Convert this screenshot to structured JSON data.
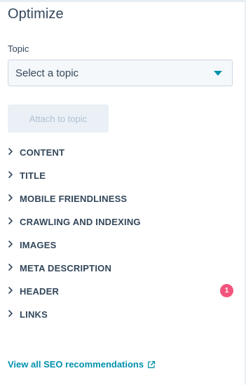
{
  "panel": {
    "title": "Optimize"
  },
  "topic": {
    "label": "Topic",
    "selected": "Select a topic"
  },
  "attach_button": {
    "label": "Attach to topic",
    "disabled": true
  },
  "categories": [
    {
      "label": "CONTENT"
    },
    {
      "label": "TITLE"
    },
    {
      "label": "MOBILE FRIENDLINESS"
    },
    {
      "label": "CRAWLING AND INDEXING"
    },
    {
      "label": "IMAGES"
    },
    {
      "label": "META DESCRIPTION"
    },
    {
      "label": "HEADER",
      "badge": "1"
    },
    {
      "label": "LINKS"
    }
  ],
  "footer": {
    "link_label": "View all SEO recommendations"
  },
  "colors": {
    "accent": "#0091ae",
    "text": "#33475b",
    "badge": "#f2547d",
    "disabled_bg": "#eaf0f6",
    "disabled_text": "#b0c1d4"
  },
  "icons": {
    "chevron": "chevron-right-icon",
    "dropdown": "caret-down-icon",
    "external": "external-link-icon"
  }
}
